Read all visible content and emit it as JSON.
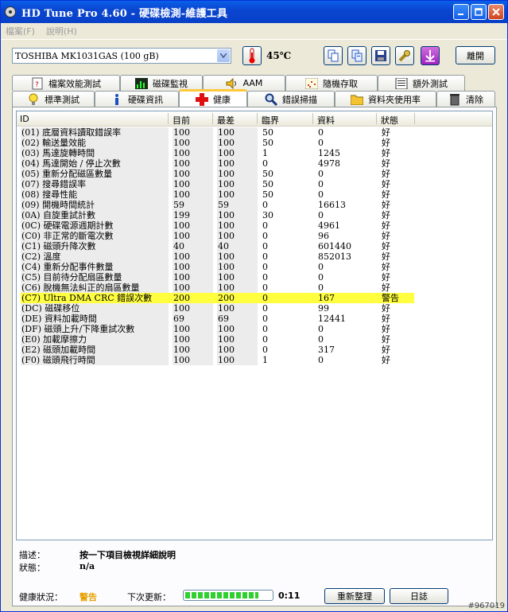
{
  "window": {
    "title": "HD Tune Pro 4.60 - 硬碟檢測-維護工具"
  },
  "menu": [
    "檔案(F)",
    "說明(H)"
  ],
  "toolbar": {
    "drive": "TOSHIBA MK1031GAS (100 gB)",
    "temperature": "45℃",
    "exit_label": "離開"
  },
  "tabs_top": [
    {
      "label": "檔案效能測試",
      "icon": "file-benchmark-icon"
    },
    {
      "label": "磁碟監視",
      "icon": "bar-chart-icon"
    },
    {
      "label": "AAM",
      "icon": "speaker-icon"
    },
    {
      "label": "隨機存取",
      "icon": "random-access-icon"
    },
    {
      "label": "額外測試",
      "icon": "extra-tests-icon"
    }
  ],
  "tabs_bottom": [
    {
      "label": "標準測試",
      "icon": "lightbulb-icon"
    },
    {
      "label": "硬碟資訊",
      "icon": "info-icon"
    },
    {
      "label": "健康",
      "icon": "health-cross-icon"
    },
    {
      "label": "錯誤掃描",
      "icon": "magnifier-icon"
    },
    {
      "label": "資料夾使用率",
      "icon": "folder-icon"
    },
    {
      "label": "清除",
      "icon": "trash-icon"
    }
  ],
  "table": {
    "headers": {
      "id": "ID",
      "current": "目前",
      "worst": "最差",
      "threshold": "臨界",
      "data": "資料",
      "status": "狀態"
    },
    "rows": [
      {
        "id": "(01) 底層資料讀取錯誤率",
        "current": "100",
        "worst": "100",
        "threshold": "50",
        "data": "0",
        "status": "好",
        "warn": false
      },
      {
        "id": "(02) 輸送量效能",
        "current": "100",
        "worst": "100",
        "threshold": "50",
        "data": "0",
        "status": "好",
        "warn": false
      },
      {
        "id": "(03) 馬達旋轉時間",
        "current": "100",
        "worst": "100",
        "threshold": "1",
        "data": "1245",
        "status": "好",
        "warn": false
      },
      {
        "id": "(04) 馬達開始 / 停止次數",
        "current": "100",
        "worst": "100",
        "threshold": "0",
        "data": "4978",
        "status": "好",
        "warn": false
      },
      {
        "id": "(05) 重新分配磁區數量",
        "current": "100",
        "worst": "100",
        "threshold": "50",
        "data": "0",
        "status": "好",
        "warn": false
      },
      {
        "id": "(07) 搜尋錯誤率",
        "current": "100",
        "worst": "100",
        "threshold": "50",
        "data": "0",
        "status": "好",
        "warn": false
      },
      {
        "id": "(08) 搜尋性能",
        "current": "100",
        "worst": "100",
        "threshold": "50",
        "data": "0",
        "status": "好",
        "warn": false
      },
      {
        "id": "(09) 開機時間統計",
        "current": "59",
        "worst": "59",
        "threshold": "0",
        "data": "16613",
        "status": "好",
        "warn": false
      },
      {
        "id": "(0A) 自旋重試計數",
        "current": "199",
        "worst": "100",
        "threshold": "30",
        "data": "0",
        "status": "好",
        "warn": false
      },
      {
        "id": "(0C) 硬碟電源週期計數",
        "current": "100",
        "worst": "100",
        "threshold": "0",
        "data": "4961",
        "status": "好",
        "warn": false
      },
      {
        "id": "(C0) 非正常的斷電次數",
        "current": "100",
        "worst": "100",
        "threshold": "0",
        "data": "96",
        "status": "好",
        "warn": false
      },
      {
        "id": "(C1) 磁頭升降次數",
        "current": "40",
        "worst": "40",
        "threshold": "0",
        "data": "601440",
        "status": "好",
        "warn": false
      },
      {
        "id": "(C2) 溫度",
        "current": "100",
        "worst": "100",
        "threshold": "0",
        "data": "852013",
        "status": "好",
        "warn": false
      },
      {
        "id": "(C4) 重新分配事件數量",
        "current": "100",
        "worst": "100",
        "threshold": "0",
        "data": "0",
        "status": "好",
        "warn": false
      },
      {
        "id": "(C5) 目前待分配扇區數量",
        "current": "100",
        "worst": "100",
        "threshold": "0",
        "data": "0",
        "status": "好",
        "warn": false
      },
      {
        "id": "(C6) 脫機無法糾正的扇區數量",
        "current": "100",
        "worst": "100",
        "threshold": "0",
        "data": "0",
        "status": "好",
        "warn": false
      },
      {
        "id": "(C7) Ultra DMA CRC 錯誤次數",
        "current": "200",
        "worst": "200",
        "threshold": "0",
        "data": "167",
        "status": "警告",
        "warn": true
      },
      {
        "id": "(DC) 磁碟移位",
        "current": "100",
        "worst": "100",
        "threshold": "0",
        "data": "99",
        "status": "好",
        "warn": false
      },
      {
        "id": "(DE) 資料加載時間",
        "current": "69",
        "worst": "69",
        "threshold": "0",
        "data": "12441",
        "status": "好",
        "warn": false
      },
      {
        "id": "(DF) 磁頭上升/下降重試次數",
        "current": "100",
        "worst": "100",
        "threshold": "0",
        "data": "0",
        "status": "好",
        "warn": false
      },
      {
        "id": "(E0) 加載摩擦力",
        "current": "100",
        "worst": "100",
        "threshold": "0",
        "data": "0",
        "status": "好",
        "warn": false
      },
      {
        "id": "(E2) 磁頭加載時間",
        "current": "100",
        "worst": "100",
        "threshold": "0",
        "data": "317",
        "status": "好",
        "warn": false
      },
      {
        "id": "(F0) 磁頭飛行時間",
        "current": "100",
        "worst": "100",
        "threshold": "1",
        "data": "0",
        "status": "好",
        "warn": false
      }
    ]
  },
  "info": {
    "desc_label": "描述：",
    "desc_value": "按一下項目檢視詳細說明",
    "status_label": "狀態：",
    "status_value": "n/a"
  },
  "footer": {
    "health_label": "健康狀況：",
    "health_value": "警告",
    "next_update_label": "下次更新：",
    "progress_fraction": 0.85,
    "time": "0:11",
    "refresh_label": "重新整理",
    "log_label": "日誌"
  },
  "watermark": "#967019",
  "colors": {
    "warn_row": "#ffff40",
    "health_warn": "#e8a000",
    "title_bar": "#0a46d0"
  }
}
